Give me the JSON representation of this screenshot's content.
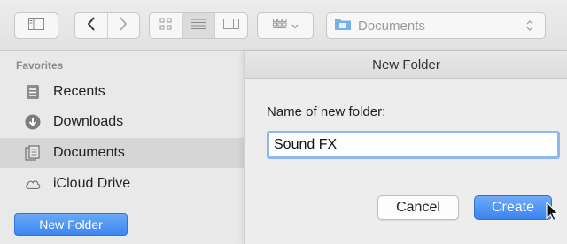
{
  "toolbar": {
    "icons": [
      "sidebar-toggle-icon",
      "back-icon",
      "forward-icon",
      "icon-view-icon",
      "list-view-icon",
      "column-view-icon",
      "group-by-icon",
      "chevron-down-icon"
    ],
    "path_popup": {
      "label": "Documents",
      "icon": "folder-icon"
    }
  },
  "sidebar": {
    "heading": "Favorites",
    "items": [
      {
        "label": "Recents",
        "icon": "recents-icon",
        "selected": false
      },
      {
        "label": "Downloads",
        "icon": "downloads-icon",
        "selected": false
      },
      {
        "label": "Documents",
        "icon": "documents-icon",
        "selected": true
      },
      {
        "label": "iCloud Drive",
        "icon": "cloud-icon",
        "selected": false
      }
    ],
    "new_folder_label": "New Folder"
  },
  "dialog": {
    "title": "New Folder",
    "field_label": "Name of new folder:",
    "field_value": "Sound FX",
    "cancel_label": "Cancel",
    "create_label": "Create"
  },
  "colors": {
    "accent": "#3b86f2",
    "focus_ring": "#8fb8f1",
    "selection": "#d6d6d6"
  }
}
